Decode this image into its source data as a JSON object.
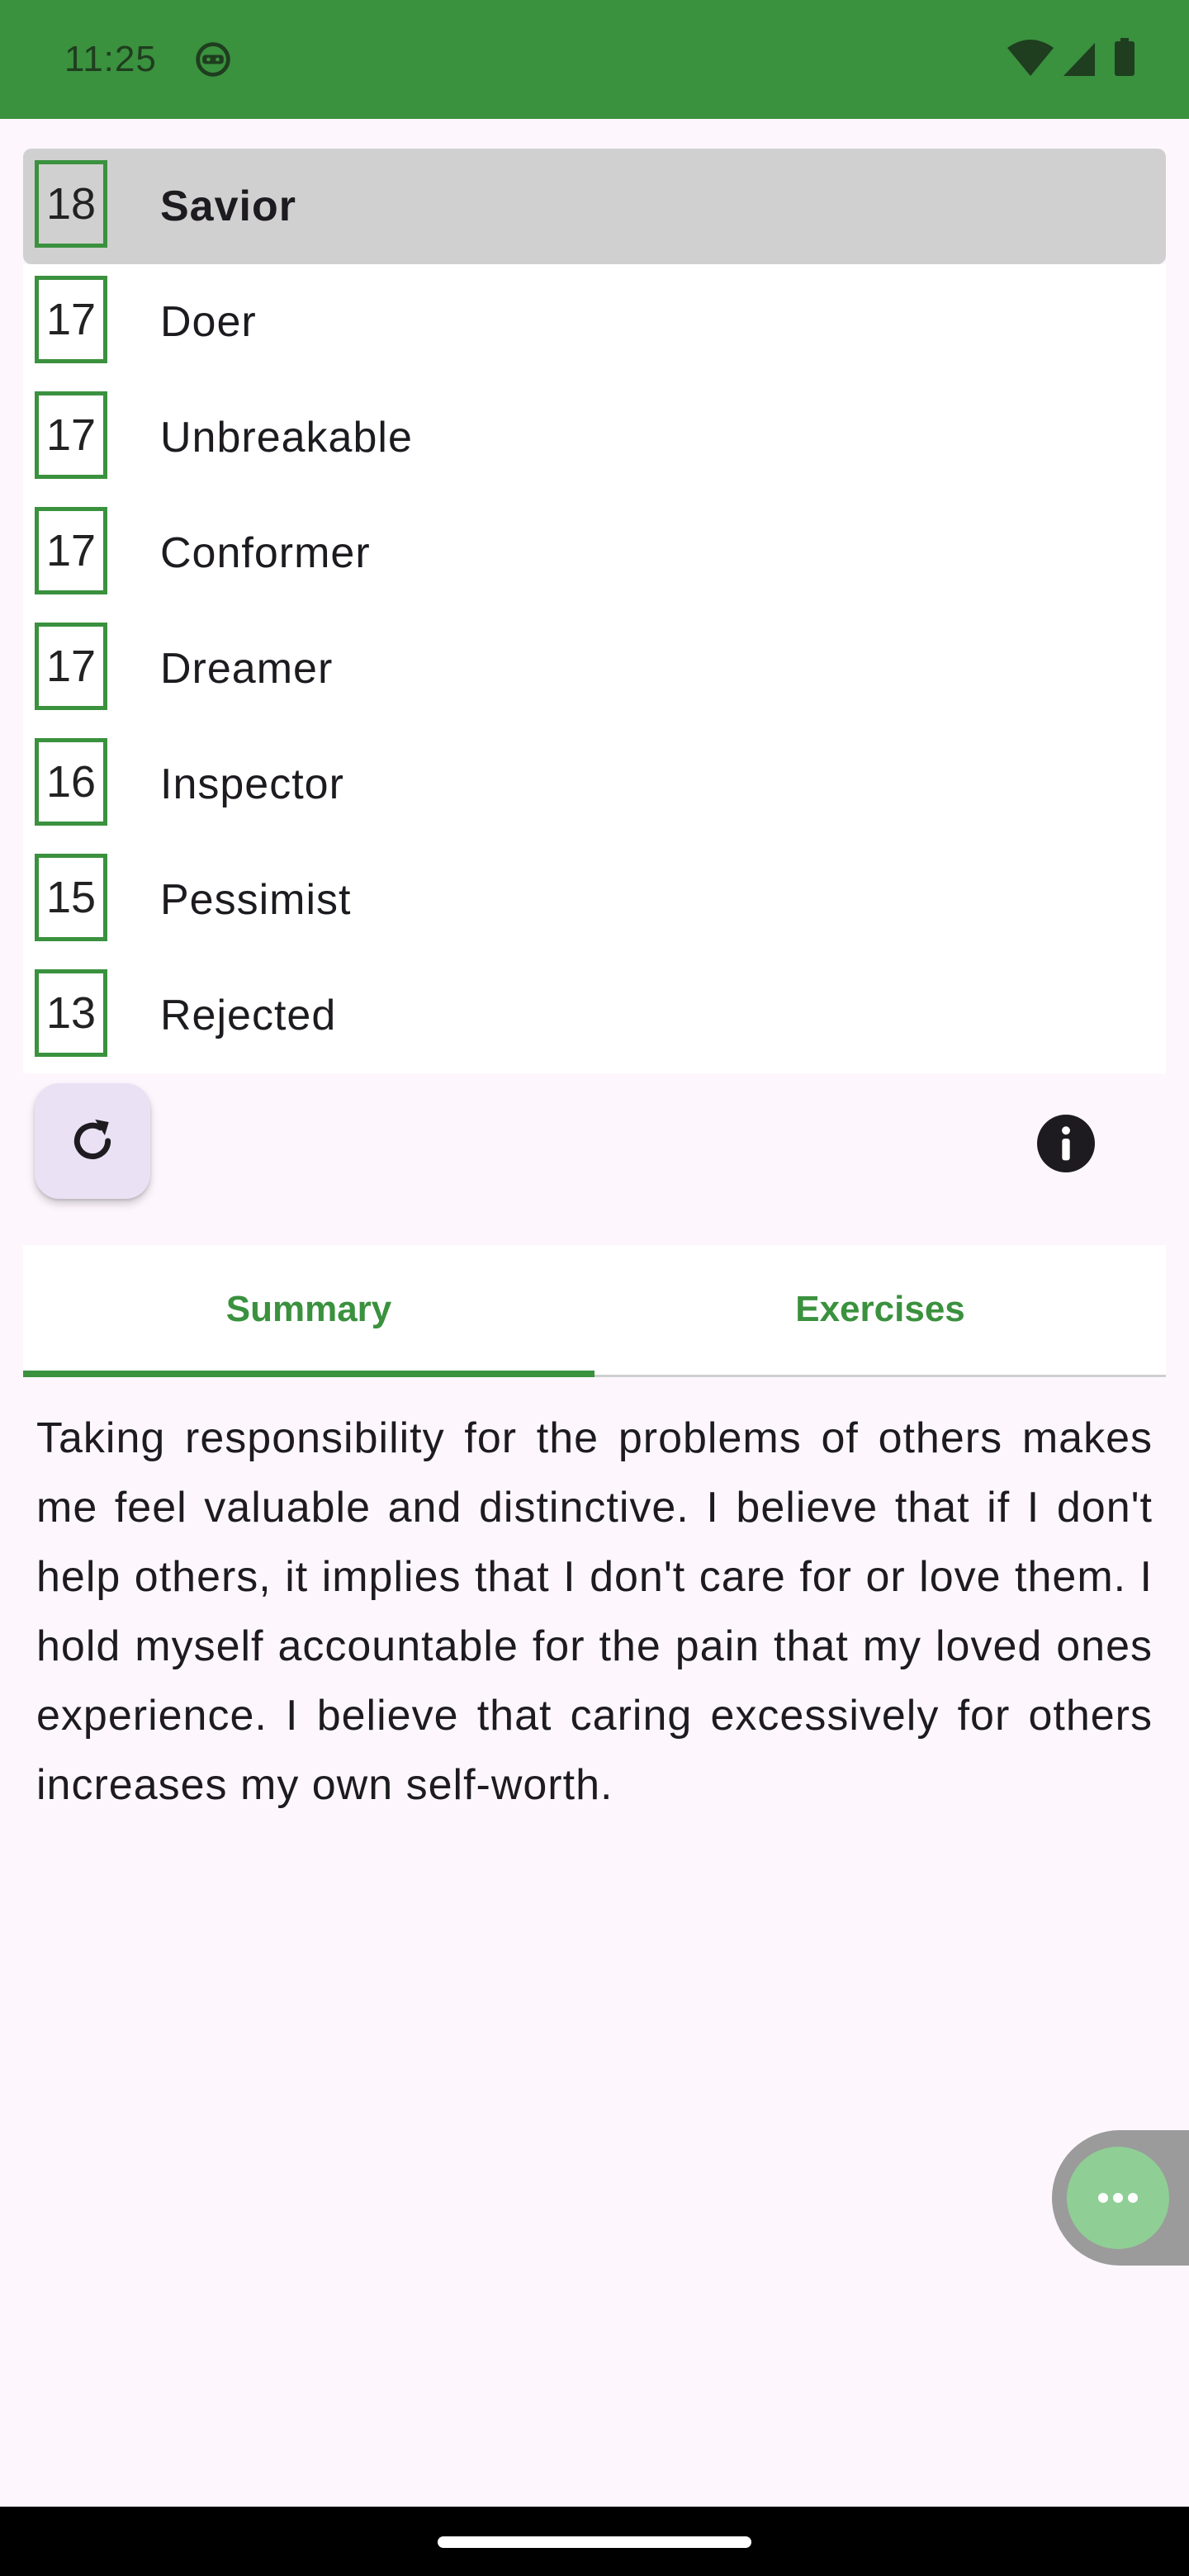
{
  "status_bar": {
    "time": "11:25",
    "icons": [
      "face-icon",
      "wifi-icon",
      "signal-icon",
      "battery-icon"
    ]
  },
  "list": {
    "items": [
      {
        "score": "18",
        "label": "Savior",
        "selected": true
      },
      {
        "score": "17",
        "label": "Doer",
        "selected": false
      },
      {
        "score": "17",
        "label": "Unbreakable",
        "selected": false
      },
      {
        "score": "17",
        "label": "Conformer",
        "selected": false
      },
      {
        "score": "17",
        "label": "Dreamer",
        "selected": false
      },
      {
        "score": "16",
        "label": "Inspector",
        "selected": false
      },
      {
        "score": "15",
        "label": "Pessimist",
        "selected": false
      },
      {
        "score": "13",
        "label": "Rejected",
        "selected": false
      }
    ]
  },
  "actions": {
    "refresh_icon": "refresh-icon",
    "info_icon": "info-icon"
  },
  "tabs": {
    "items": [
      {
        "label": "Summary",
        "active": true
      },
      {
        "label": "Exercises",
        "active": false
      }
    ]
  },
  "summary": {
    "text": "Taking responsibility for the problems of others makes me feel valuable and distinctive. I believe that if I don't help others, it implies that I don't care for or love them. I hold myself accountable for the pain that my loved ones experience. I believe that caring excessively for others increases my own self-worth."
  },
  "floating_menu": {
    "icon": "more-horizontal-icon"
  },
  "colors": {
    "primary": "#3a913e",
    "background": "#fdf7fd",
    "selected_row": "#d0d0d0",
    "fab_background": "#ebe1f5",
    "floating_menu": "#8fce95"
  }
}
